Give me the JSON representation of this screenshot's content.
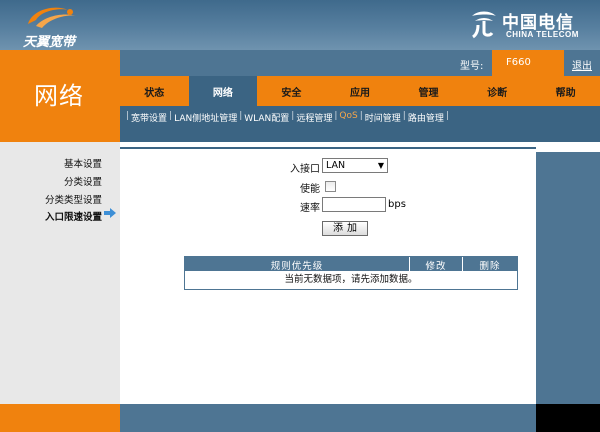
{
  "brand": {
    "left_logo_text": "天翼宽带",
    "right_logo_cn": "中国电信",
    "right_logo_en": "CHINA TELECOM"
  },
  "header": {
    "model_label": "型号:",
    "model_value": "F660",
    "logout": "退出"
  },
  "section_title": "网络",
  "tabs": [
    {
      "label": "状态",
      "active": false
    },
    {
      "label": "网络",
      "active": true
    },
    {
      "label": "安全",
      "active": false
    },
    {
      "label": "应用",
      "active": false
    },
    {
      "label": "管理",
      "active": false
    },
    {
      "label": "诊断",
      "active": false
    },
    {
      "label": "帮助",
      "active": false
    }
  ],
  "subnav": [
    {
      "label": "宽带设置",
      "active": false
    },
    {
      "label": "LAN侧地址管理",
      "active": false
    },
    {
      "label": "WLAN配置",
      "active": false
    },
    {
      "label": "远程管理",
      "active": false
    },
    {
      "label": "QoS",
      "active": true
    },
    {
      "label": "时间管理",
      "active": false
    },
    {
      "label": "路由管理",
      "active": false
    }
  ],
  "sidebar": {
    "items": [
      {
        "label": "基本设置",
        "active": false
      },
      {
        "label": "分类设置",
        "active": false
      },
      {
        "label": "分类类型设置",
        "active": false
      },
      {
        "label": "入口限速设置",
        "active": true
      }
    ]
  },
  "form": {
    "port_label": "入接口",
    "port_value": "LAN",
    "enable_label": "使能",
    "enable_checked": false,
    "rate_label": "速率",
    "rate_value": "",
    "rate_unit": "bps",
    "add_button": "添加"
  },
  "table": {
    "columns": [
      "规则优先级",
      "修改",
      "删除"
    ],
    "empty_text": "当前无数据项，请先添加数据。"
  },
  "colors": {
    "orange": "#f0820e",
    "blue_dark": "#3b6483",
    "blue": "#4e7593"
  }
}
